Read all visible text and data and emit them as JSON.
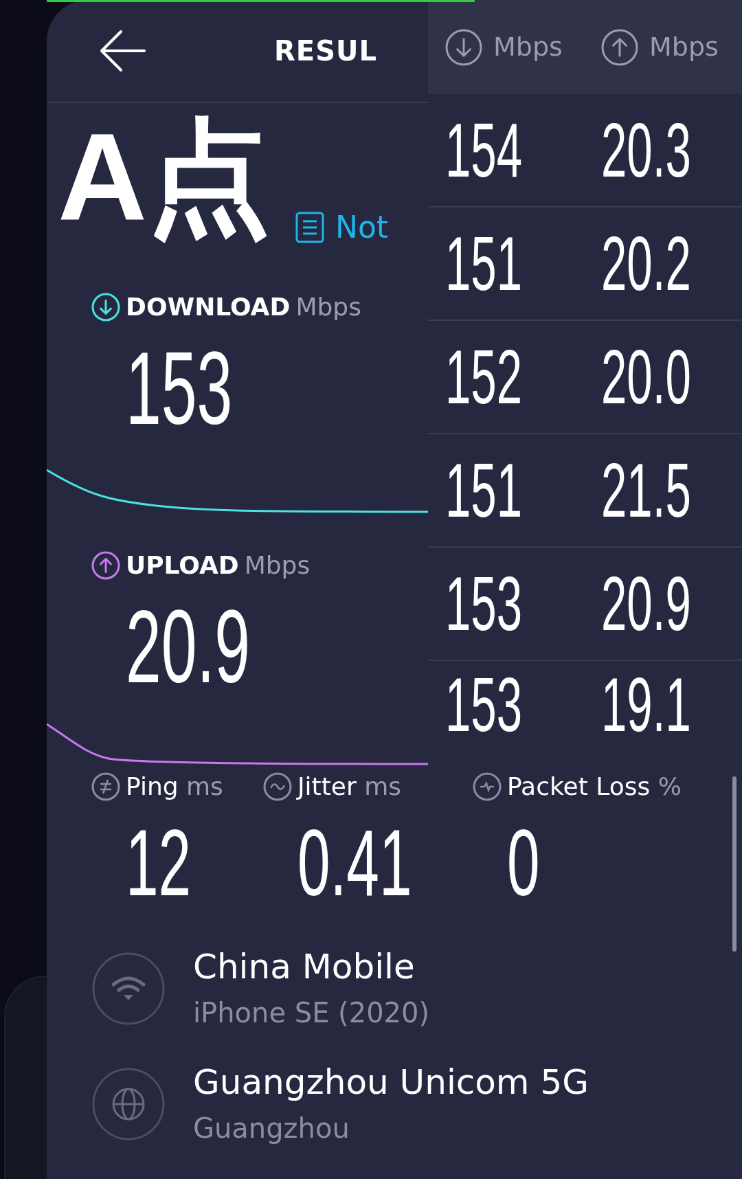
{
  "header": {
    "title": "RESUL"
  },
  "tag": {
    "text": "A点"
  },
  "note": {
    "label": "Not"
  },
  "results": [
    {
      "kind": "download",
      "label": "DOWNLOAD",
      "unit": "Mbps",
      "value": "153"
    },
    {
      "kind": "upload",
      "label": "UPLOAD",
      "unit": "Mbps",
      "value": "20.9"
    }
  ],
  "stats": [
    {
      "kind": "ping",
      "label": "Ping",
      "unit": "ms",
      "value": "12"
    },
    {
      "kind": "jitter",
      "label": "Jitter",
      "unit": "ms",
      "value": "0.41"
    },
    {
      "kind": "packet_loss",
      "label": "Packet Loss",
      "unit": "%",
      "value": "0"
    }
  ],
  "connections": [
    {
      "kind": "carrier",
      "title": "China Mobile",
      "subtitle": "iPhone SE (2020)"
    },
    {
      "kind": "server",
      "title": "Guangzhou Unicom 5G",
      "subtitle": "Guangzhou"
    }
  ],
  "history": {
    "columns": [
      {
        "kind": "download",
        "unit": "Mbps"
      },
      {
        "kind": "upload",
        "unit": "Mbps"
      }
    ],
    "rows": [
      [
        "154",
        "20.3"
      ],
      [
        "151",
        "20.2"
      ],
      [
        "152",
        "20.0"
      ],
      [
        "151",
        "21.5"
      ],
      [
        "153",
        "20.9"
      ],
      [
        "153",
        "19.1"
      ]
    ]
  }
}
